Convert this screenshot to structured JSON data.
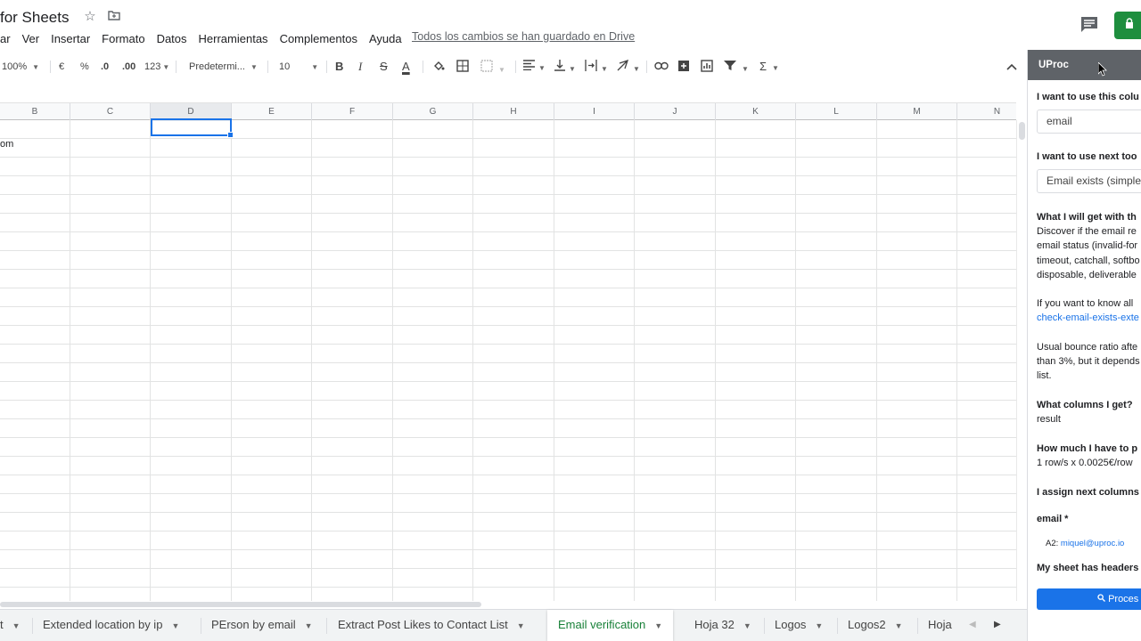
{
  "app": {
    "title": "for Sheets",
    "icons": [
      "star-icon",
      "folder-icon",
      "comment-icon",
      "lock-icon"
    ]
  },
  "menu": {
    "items": [
      "ar",
      "Ver",
      "Insertar",
      "Formato",
      "Datos",
      "Herramientas",
      "Complementos",
      "Ayuda"
    ],
    "save_status": "Todos los cambios se han guardado en Drive"
  },
  "toolbar": {
    "zoom": "100%",
    "currency": "€",
    "percent": "%",
    "dec_decrease": ".0",
    "dec_increase": ".00",
    "more_formats": "123",
    "font": "Predetermi...",
    "font_size": "10",
    "bold": "B",
    "italic": "I",
    "strike": "S",
    "text_color": "A",
    "sigma": "Σ"
  },
  "grid": {
    "columns": [
      "B",
      "C",
      "D",
      "E",
      "F",
      "G",
      "H",
      "I",
      "J",
      "K",
      "L",
      "M",
      "N"
    ],
    "selected_column": "D",
    "cell_b2_text": "om"
  },
  "sheets": {
    "tabs": [
      "t",
      "Extended location by ip",
      "PErson by email",
      "Extract Post Likes to Contact List",
      "Email verification",
      "Hoja 32",
      "Logos",
      "Logos2",
      "Hoja"
    ],
    "active": "Email verification"
  },
  "panel": {
    "title": "UProc",
    "q_column": "I want to use this colu",
    "column_value": "email",
    "q_tool": "I want to use next too",
    "tool_value": "Email exists (simple",
    "q_what": "What I will get with th",
    "what_lines": [
      "Discover if the email re",
      "email status (invalid-for",
      "timeout, catchall, softbo",
      "disposable, deliverable"
    ],
    "know_all": "If you want to know all",
    "know_link": "check-email-exists-exte",
    "bounce_lines": [
      "Usual bounce ratio afte",
      "than 3%, but it depends",
      "list."
    ],
    "q_columns_get": "What columns I get?",
    "columns_get_value": "result",
    "q_pay": "How much I have to p",
    "pay_value": "1 row/s x 0.0025€/row",
    "q_assign": "I assign next columns",
    "email_label": "email *",
    "email_assign_prefix": "A2:",
    "email_assign_value": "miquel@uproc.io",
    "headers_label": "My sheet has headers",
    "process_label": "Proces"
  },
  "colors": {
    "accent": "#1a73e8",
    "share_green": "#1e8e3e",
    "active_tab_green": "#188038",
    "panel_header": "#5f6368"
  }
}
